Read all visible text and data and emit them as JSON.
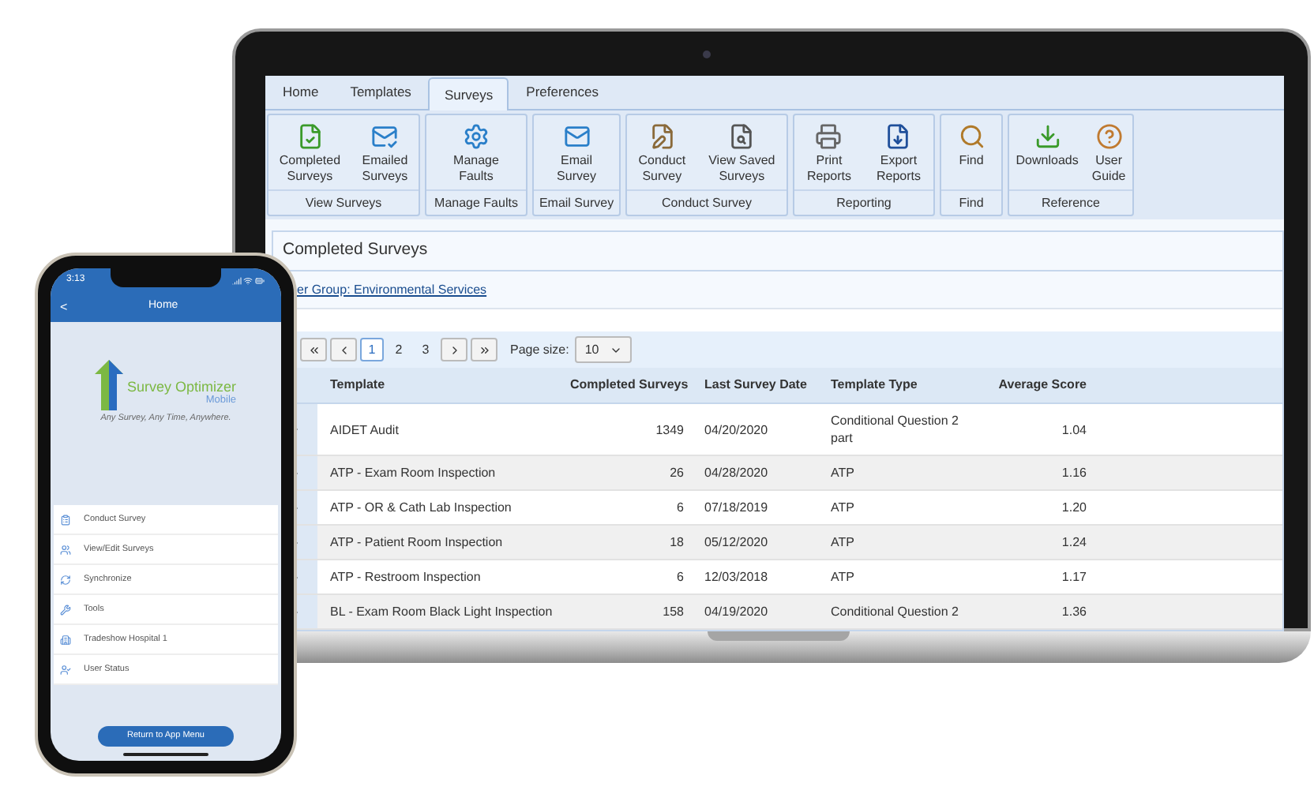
{
  "laptop": {
    "tabs": [
      {
        "label": "Home",
        "selected": false
      },
      {
        "label": "Templates",
        "selected": false
      },
      {
        "label": "Surveys",
        "selected": true
      },
      {
        "label": "Preferences",
        "selected": false
      }
    ],
    "ribbon_groups": [
      {
        "label": "View Surveys",
        "buttons": [
          "Completed\nSurveys",
          "Emailed\nSurveys"
        ]
      },
      {
        "label": "Manage Faults",
        "buttons": [
          "Manage\nFaults"
        ]
      },
      {
        "label": "Email Survey",
        "buttons": [
          "Email\nSurvey"
        ]
      },
      {
        "label": "Conduct Survey",
        "buttons": [
          "Conduct\nSurvey",
          "View Saved\nSurveys"
        ]
      },
      {
        "label": "Reporting",
        "buttons": [
          "Print\nReports",
          "Export\nReports"
        ]
      },
      {
        "label": "Find",
        "buttons": [
          "Find"
        ]
      },
      {
        "label": "Reference",
        "buttons": [
          "Downloads",
          "User\nGuide"
        ]
      }
    ],
    "panel_title": "Completed Surveys",
    "group_link": "er Group: Environmental Services",
    "pager": {
      "pages": [
        {
          "label": "1",
          "selected": true
        },
        {
          "label": "2",
          "selected": false
        },
        {
          "label": "3",
          "selected": false
        }
      ],
      "page_size_label": "Page size:",
      "page_size": "10"
    },
    "table": {
      "columns": [
        "Template",
        "Completed Surveys",
        "Last Survey Date",
        "Template Type",
        "Average Score"
      ],
      "rows": [
        {
          "template": "AIDET Audit",
          "completed": "1349",
          "date": "04/20/2020",
          "type": "Conditional Question 2 part",
          "score": "1.04"
        },
        {
          "template": "ATP - Exam Room Inspection",
          "completed": "26",
          "date": "04/28/2020",
          "type": "ATP",
          "score": "1.16"
        },
        {
          "template": "ATP - OR & Cath Lab Inspection",
          "completed": "6",
          "date": "07/18/2019",
          "type": "ATP",
          "score": "1.20"
        },
        {
          "template": "ATP - Patient Room Inspection",
          "completed": "18",
          "date": "05/12/2020",
          "type": "ATP",
          "score": "1.24"
        },
        {
          "template": "ATP - Restroom Inspection",
          "completed": "6",
          "date": "12/03/2018",
          "type": "ATP",
          "score": "1.17"
        },
        {
          "template": "BL - Exam Room Black Light Inspection",
          "completed": "158",
          "date": "04/19/2020",
          "type": "Conditional Question 2",
          "score": "1.36"
        }
      ]
    }
  },
  "phone": {
    "time": "3:13",
    "back": "<",
    "title": "Home",
    "logo_name": "Survey Optimizer",
    "logo_sub": "Mobile",
    "tagline": "Any Survey, Any Time, Anywhere.",
    "menu": [
      "Conduct Survey",
      "View/Edit Surveys",
      "Synchronize",
      "Tools",
      "Tradeshow Hospital 1",
      "User Status"
    ],
    "button": "Return to App Menu"
  }
}
